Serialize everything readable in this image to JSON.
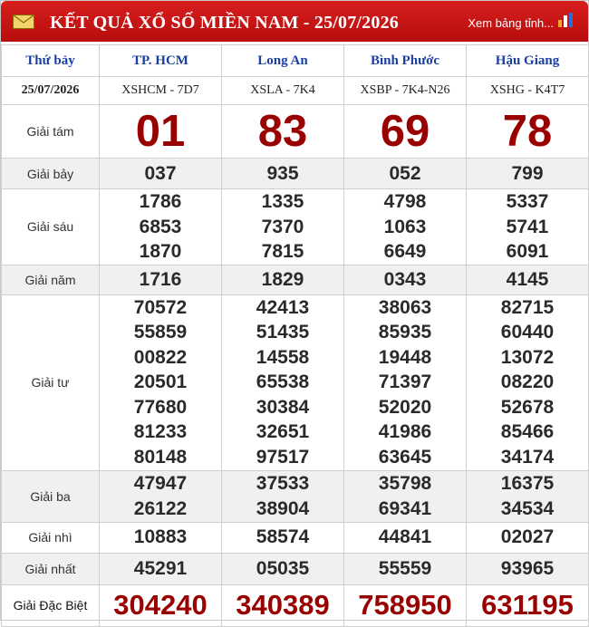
{
  "header": {
    "title": "KẾT QUẢ XỔ SỐ MIỀN NAM - 25/07/2026",
    "link": "Xem bảng tỉnh...",
    "accent_color": "#c8161d"
  },
  "columns": {
    "weekday": "Thứ bảy",
    "date": "25/07/2026",
    "provinces": [
      "TP. HCM",
      "Long An",
      "Bình Phước",
      "Hậu Giang"
    ],
    "codes": [
      "XSHCM - 7D7",
      "XSLA - 7K4",
      "XSBP - 7K4-N26",
      "XSHG - K4T7"
    ]
  },
  "prizes": {
    "g8": {
      "label": "Giải tám",
      "values": [
        "01",
        "83",
        "69",
        "78"
      ]
    },
    "g7": {
      "label": "Giải bảy",
      "values": [
        "037",
        "935",
        "052",
        "799"
      ]
    },
    "g6": {
      "label": "Giải sáu",
      "values": [
        [
          "1786",
          "6853",
          "1870"
        ],
        [
          "1335",
          "7370",
          "7815"
        ],
        [
          "4798",
          "1063",
          "6649"
        ],
        [
          "5337",
          "5741",
          "6091"
        ]
      ]
    },
    "g5": {
      "label": "Giải năm",
      "values": [
        "1716",
        "1829",
        "0343",
        "4145"
      ]
    },
    "g4": {
      "label": "Giải tư",
      "values": [
        [
          "70572",
          "55859",
          "00822",
          "20501",
          "77680",
          "81233",
          "80148"
        ],
        [
          "42413",
          "51435",
          "14558",
          "65538",
          "30384",
          "32651",
          "97517"
        ],
        [
          "38063",
          "85935",
          "19448",
          "71397",
          "52020",
          "41986",
          "63645"
        ],
        [
          "82715",
          "60440",
          "13072",
          "08220",
          "52678",
          "85466",
          "34174"
        ]
      ]
    },
    "g3": {
      "label": "Giải ba",
      "values": [
        [
          "47947",
          "26122"
        ],
        [
          "37533",
          "38904"
        ],
        [
          "35798",
          "69341"
        ],
        [
          "16375",
          "34534"
        ]
      ]
    },
    "g2": {
      "label": "Giải nhì",
      "values": [
        "10883",
        "58574",
        "44841",
        "02027"
      ]
    },
    "g1": {
      "label": "Giải nhất",
      "values": [
        "45291",
        "05035",
        "55559",
        "93965"
      ]
    },
    "special": {
      "label": "Giải Đặc Biệt",
      "values": [
        "304240",
        "340389",
        "758950",
        "631195"
      ]
    }
  }
}
